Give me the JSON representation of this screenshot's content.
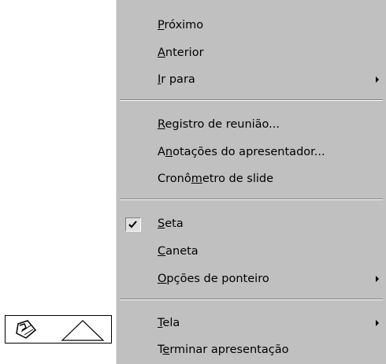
{
  "menu": {
    "items": [
      {
        "pre": "",
        "key": "P",
        "post": "róximo",
        "submenu": false,
        "checked": false
      },
      {
        "pre": "",
        "key": "A",
        "post": "nterior",
        "submenu": false,
        "checked": false
      },
      {
        "pre": "",
        "key": "I",
        "post": "r para",
        "submenu": true,
        "checked": false
      },
      {
        "pre": "",
        "key": "R",
        "post": "egistro de reunião...",
        "submenu": false,
        "checked": false
      },
      {
        "pre": "A",
        "key": "n",
        "post": "otações do apresentador...",
        "submenu": false,
        "checked": false
      },
      {
        "pre": "Cronô",
        "key": "m",
        "post": "etro de slide",
        "submenu": false,
        "checked": false
      },
      {
        "pre": "",
        "key": "S",
        "post": "eta",
        "submenu": false,
        "checked": true
      },
      {
        "pre": "",
        "key": "C",
        "post": "aneta",
        "submenu": false,
        "checked": false
      },
      {
        "pre": "",
        "key": "O",
        "post": "pções de ponteiro",
        "submenu": true,
        "checked": false
      },
      {
        "pre": "",
        "key": "T",
        "post": "ela",
        "submenu": true,
        "checked": false
      },
      {
        "pre": "T",
        "key": "e",
        "post": "rminar apresentação",
        "submenu": false,
        "checked": false
      }
    ]
  },
  "toolbar": {
    "pen_icon": "pen-icon",
    "menu_icon": "menu-triangle-icon"
  },
  "colors": {
    "menu_bg": "#c0c0c0",
    "text": "#000000",
    "separator_dark": "#808080",
    "separator_light": "#ffffff"
  }
}
